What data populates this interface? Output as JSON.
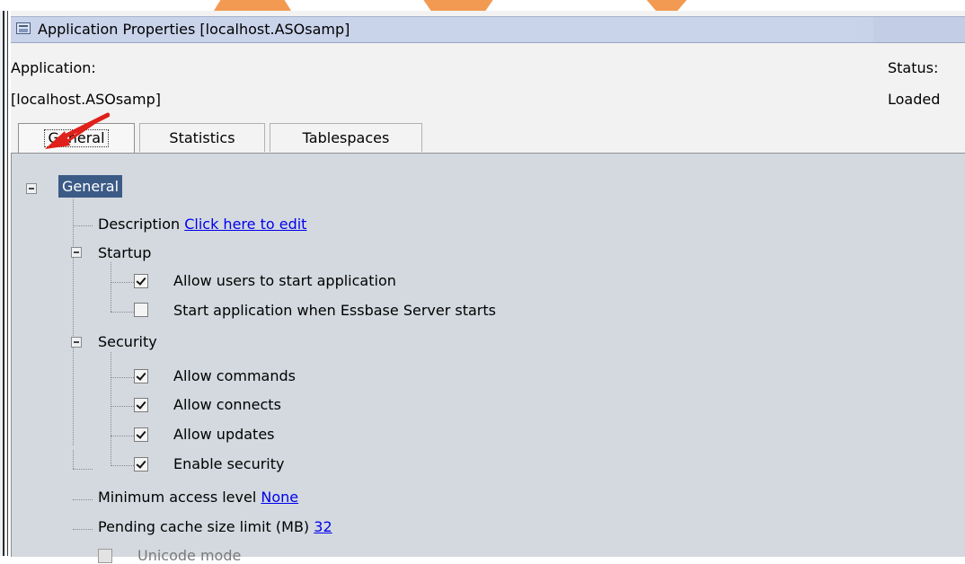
{
  "window": {
    "title": "Application Properties [localhost.ASOsamp]"
  },
  "header": {
    "application_label": "Application:",
    "application_value": "[localhost.ASOsamp]",
    "status_label": "Status:",
    "status_value": "Loaded"
  },
  "tabs": [
    {
      "label": "General",
      "active": true
    },
    {
      "label": "Statistics",
      "active": false
    },
    {
      "label": "Tablespaces",
      "active": false
    }
  ],
  "tree": {
    "root_label": "General",
    "description_label": "Description",
    "description_link": "Click here to edit",
    "startup": {
      "label": "Startup",
      "items": [
        {
          "label": "Allow users to start application",
          "checked": true
        },
        {
          "label": "Start application when Essbase Server starts",
          "checked": false
        }
      ]
    },
    "security": {
      "label": "Security",
      "items": [
        {
          "label": "Allow commands",
          "checked": true
        },
        {
          "label": "Allow connects",
          "checked": true
        },
        {
          "label": "Allow updates",
          "checked": true
        },
        {
          "label": "Enable security",
          "checked": true
        }
      ]
    },
    "min_access_label": "Minimum access level",
    "min_access_value": "None",
    "pending_cache_label": "Pending cache size limit (MB)",
    "pending_cache_value": "32",
    "unicode_label": "Unicode mode",
    "unicode_checked": false,
    "unicode_disabled": true
  },
  "colors": {
    "selection": "#3b5a86",
    "tree_background": "#d3d9df",
    "link": "#0000ee",
    "annotation_arrow": "#e0201a",
    "banner_orange": "#f29a52"
  }
}
